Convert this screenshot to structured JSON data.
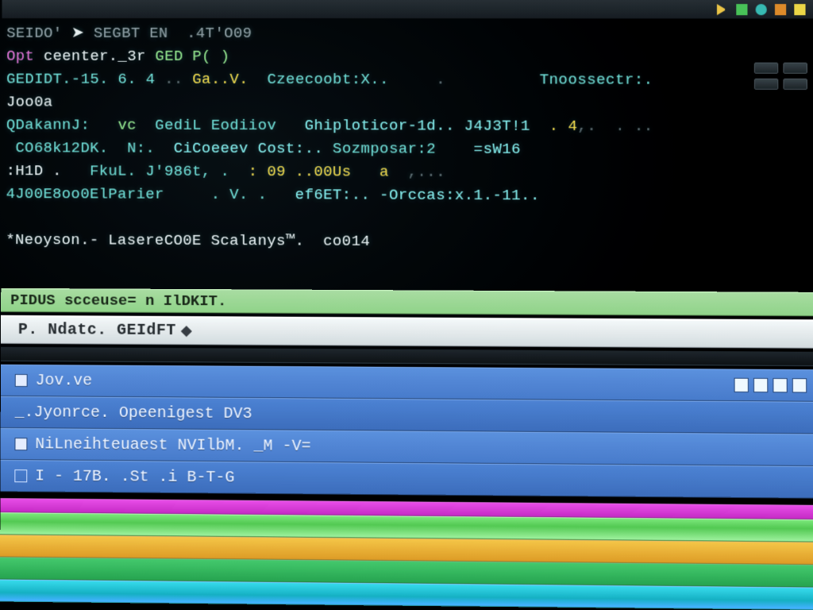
{
  "toolbar_top": {
    "icons": [
      "play-icon",
      "square-green-icon",
      "circle-teal-icon",
      "square-orange-icon",
      "square-yellow-icon"
    ]
  },
  "terminal": {
    "lines": [
      {
        "segments": [
          {
            "cls": "c-grey",
            "t": "SEIDO'"
          },
          {
            "cls": "c-white",
            "t": " ➤ "
          },
          {
            "cls": "c-grey",
            "t": "SEGBT EN  .4T'O09"
          }
        ]
      },
      {
        "segments": [
          {
            "cls": "c-mag",
            "t": "Opt"
          },
          {
            "cls": "c-white",
            "t": " ceenter._3r "
          },
          {
            "cls": "c-green",
            "t": "GED P( )"
          }
        ]
      },
      {
        "segments": [
          {
            "cls": "c-teal",
            "t": "GEDIDT"
          },
          {
            "cls": "c-teal",
            "t": ".-15. 6. 4"
          },
          {
            "cls": "c-dim",
            "t": " .. "
          },
          {
            "cls": "c-yellow",
            "t": "Ga..V."
          },
          {
            "cls": "c-teal",
            "t": "  Czeecoobt:X.."
          },
          {
            "cls": "c-dim",
            "t": "     .          "
          },
          {
            "cls": "c-teal",
            "t": "Tnoossectr:."
          }
        ]
      },
      {
        "segments": [
          {
            "cls": "c-white",
            "t": "Joo0a"
          }
        ]
      },
      {
        "segments": [
          {
            "cls": "c-teal",
            "t": "QDakannJ:   "
          },
          {
            "cls": "c-green",
            "t": "vc"
          },
          {
            "cls": "c-teal",
            "t": "  GediL Eodiiov   "
          },
          {
            "cls": "c-cyan",
            "t": "Ghiploticor-1d.. J4J3T!1"
          },
          {
            "cls": "c-yellow",
            "t": "  . 4"
          },
          {
            "cls": "c-dim",
            "t": ",.  . .."
          }
        ]
      },
      {
        "segments": [
          {
            "cls": "c-teal",
            "t": " CO68k12DK.  N:.  "
          },
          {
            "cls": "c-cyan",
            "t": "CiCoeeev Cost:.. "
          },
          {
            "cls": "c-teal",
            "t": "Sozmposar:2    "
          },
          {
            "cls": "c-cyan",
            "t": "=sW16"
          }
        ]
      },
      {
        "segments": [
          {
            "cls": "c-white",
            "t": ":H1D ."
          },
          {
            "cls": "c-teal",
            "t": "   FkuL. J'986t, ."
          },
          {
            "cls": "c-yellow",
            "t": "  : 09 ..00Us   a"
          },
          {
            "cls": "c-dim",
            "t": "  ,..."
          }
        ]
      },
      {
        "segments": [
          {
            "cls": "c-teal",
            "t": "4J00E8oo0ElParier     . V. ."
          },
          {
            "cls": "c-cyan",
            "t": "   ef6ET:.. -Orccas:x.1.-11.."
          }
        ]
      },
      {
        "segments": [
          {
            "cls": "c-grey",
            "t": ""
          }
        ]
      },
      {
        "segments": [
          {
            "cls": "c-white",
            "t": "*Neoyson.- LasereCO0E Scalanys™.  co014"
          }
        ]
      }
    ]
  },
  "selection": {
    "green": "PIDUS scceuse= n IlDKIT.",
    "silver": "P. Ndatc. GEIdFT"
  },
  "panel": {
    "rows": [
      {
        "icon": "square-icon",
        "label": "Jov.ve"
      },
      {
        "icon": "",
        "label": " _.Jyonrce. Opeenigest DV3"
      },
      {
        "icon": "square-icon",
        "label": "NiLneihteuaest NVIlbM.  _M  -V="
      },
      {
        "icon": "outline-square-icon",
        "label": "I - 17B.  .St .i  B-T-G"
      }
    ]
  },
  "colorbars": {
    "bars": [
      "magenta",
      "light-green",
      "amber",
      "green",
      "cyan"
    ]
  }
}
